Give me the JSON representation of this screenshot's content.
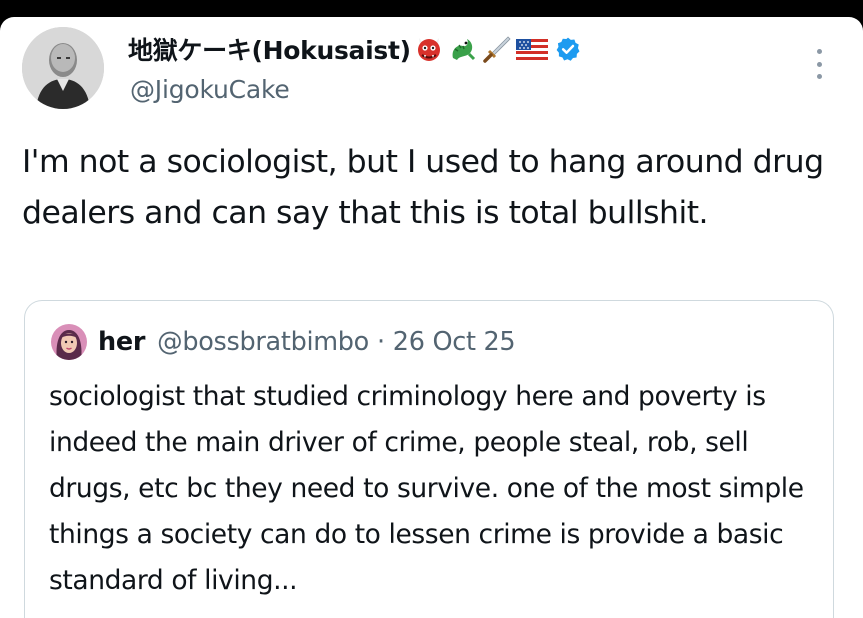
{
  "tweet": {
    "display_name": "地獄ケーキ(Hokusaist)",
    "name_emojis": [
      "ogre-emoji",
      "dragon-emoji",
      "dagger-emoji",
      "us-flag-emoji"
    ],
    "verified": true,
    "handle": "@JigokuCake",
    "text": "I'm not a sociologist, but I used to hang around drug dealers and can say that this is total bullshit."
  },
  "quoted": {
    "display_name": "her",
    "handle": "@bossbratbimbo",
    "separator": "·",
    "date": "26 Oct 25",
    "text": "sociologist that studied criminology here and poverty is indeed the main driver of crime, people steal, rob, sell drugs, etc bc they need to survive. one of the most simple things a society can do to lessen crime is provide a basic standard of living..."
  },
  "colors": {
    "text_primary": "#0f1419",
    "text_secondary": "#536471",
    "verified_blue": "#1d9bf0",
    "border": "#cfd9de",
    "frame": "#000000"
  }
}
